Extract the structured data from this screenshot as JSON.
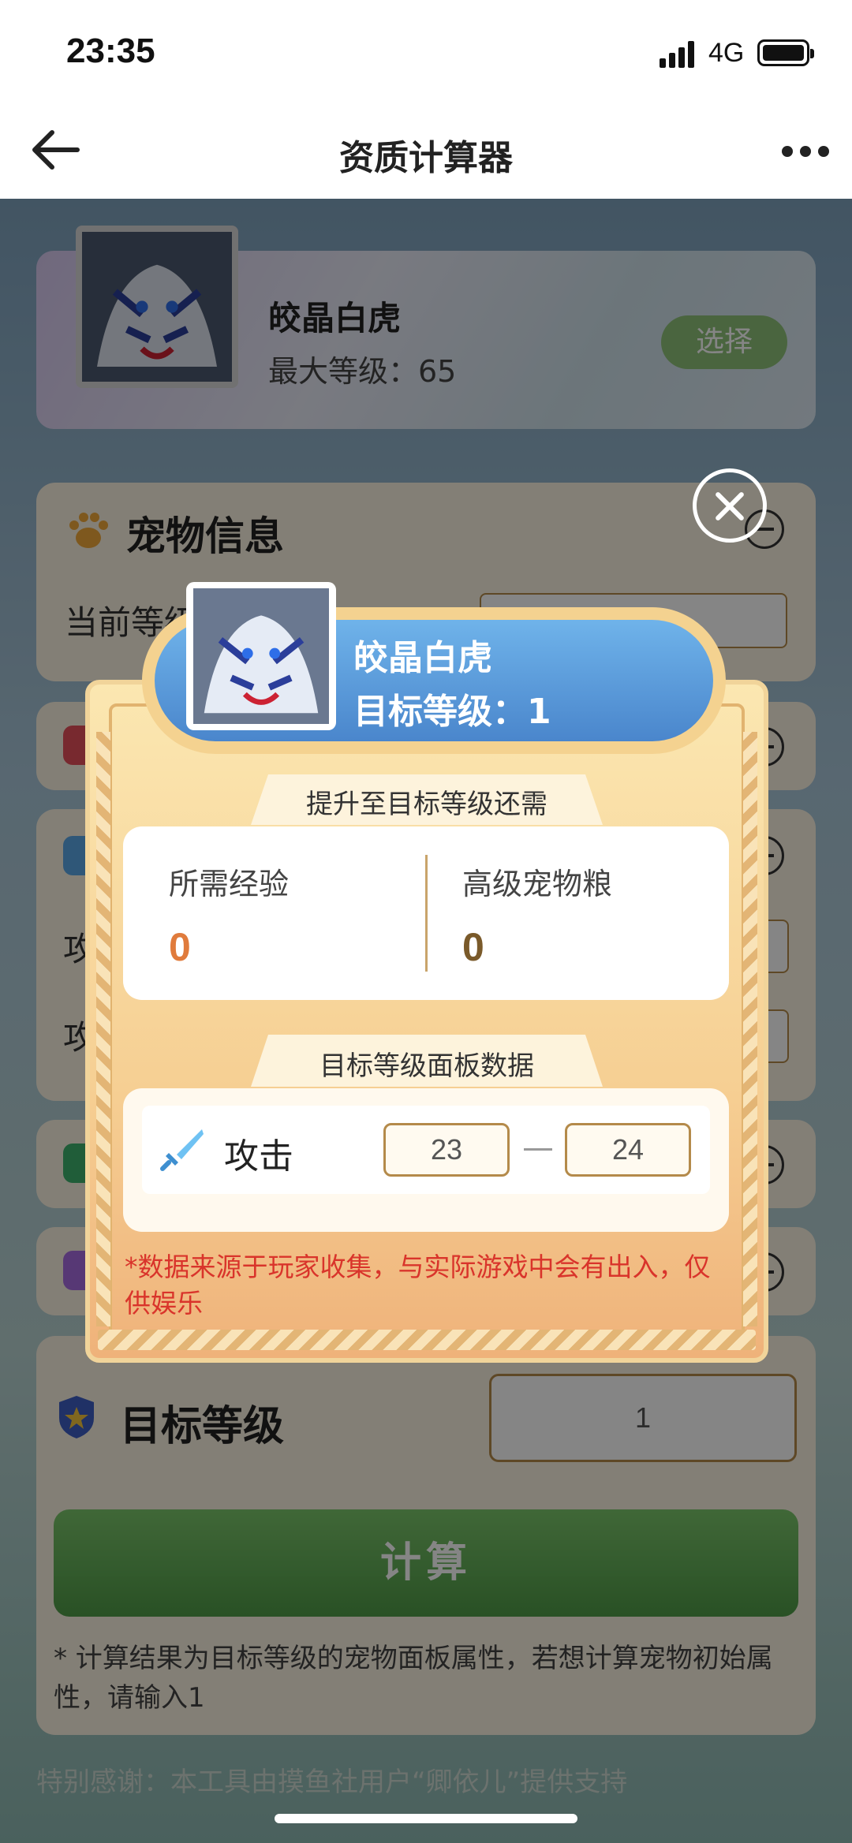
{
  "status_bar": {
    "time": "23:35",
    "network": "4G"
  },
  "nav": {
    "title": "资质计算器"
  },
  "pet": {
    "name": "皎晶白虎",
    "max_level": "最大等级：65",
    "select_label": "选择"
  },
  "info_section": {
    "title": "宠物信息",
    "current_level_label": "当前等级"
  },
  "attack_section": {
    "label_1": "攻",
    "label_2": "攻"
  },
  "target_section": {
    "title": "目标等级",
    "value": "1"
  },
  "calc_button": "计算",
  "calc_note": "* 计算结果为目标等级的宠物面板属性，若想计算宠物初始属性，请输入1",
  "thanks": "特别感谢：本工具由摸鱼社用户“卿依儿”提供支持",
  "modal": {
    "pet_name": "皎晶白虎",
    "target_level": "目标等级：1",
    "need_title": "提升至目标等级还需",
    "exp_label": "所需经验",
    "exp_value": "0",
    "food_label": "高级宠物粮",
    "food_value": "0",
    "panel_title": "目标等级面板数据",
    "attack_label": "攻击",
    "attack_min": "23",
    "attack_max": "24",
    "disclaimer": "*数据来源于玩家收集，与实际游戏中会有出入，仅供娱乐"
  },
  "colors": {
    "accent_green": "#4f9b47",
    "banner_blue": "#4a86cc",
    "exp_orange": "#e07b3c",
    "warning_red": "#d9342b"
  }
}
